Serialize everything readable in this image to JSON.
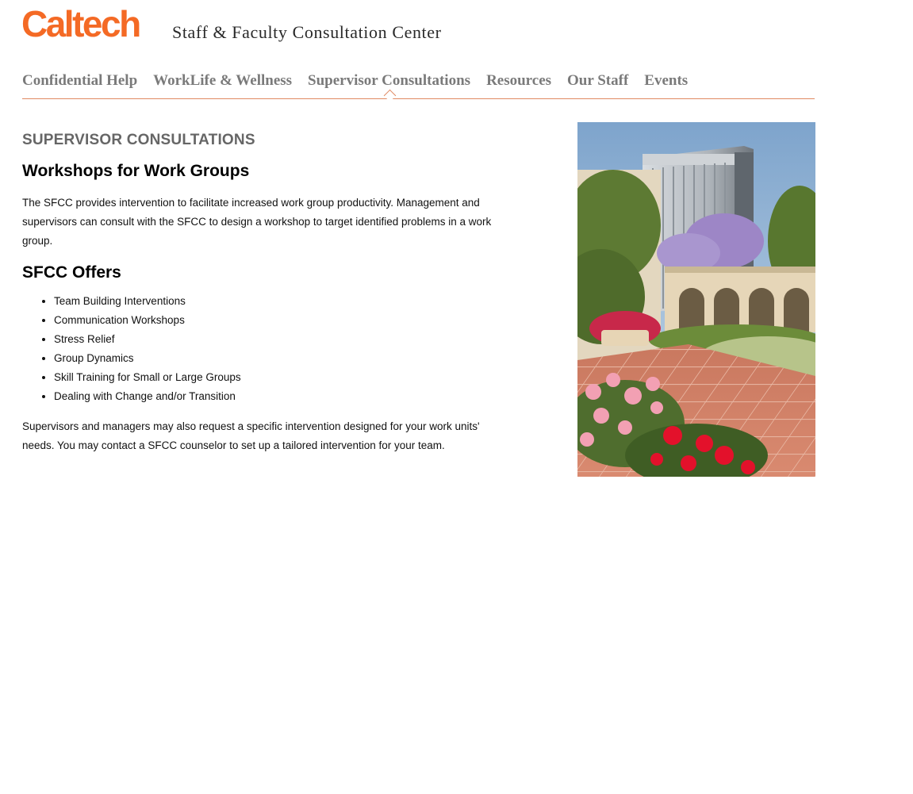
{
  "header": {
    "logo_text": "Caltech",
    "site_title": "Staff & Faculty Consultation Center"
  },
  "nav": {
    "items": [
      {
        "label": "Confidential Help"
      },
      {
        "label": "WorkLife & Wellness"
      },
      {
        "label": "Supervisor Consultations"
      },
      {
        "label": "Resources"
      },
      {
        "label": "Our Staff"
      },
      {
        "label": "Events"
      }
    ],
    "active_item": "Supervisor Consultations"
  },
  "main": {
    "section_title": "SUPERVISOR CONSULTATIONS",
    "heading_workshops": "Workshops for Work Groups",
    "intro_paragraph": "The SFCC provides intervention to facilitate increased work group productivity. Management and supervisors can consult with the SFCC to design a workshop to target identified problems in a work group.",
    "heading_offers": "SFCC Offers",
    "offers": [
      "Team Building Interventions",
      "Communication Workshops",
      "Stress Relief",
      "Group Dynamics",
      "Skill Training for Small or Large Groups",
      "Dealing with Change and/or Transition"
    ],
    "closing_paragraph": "Supervisors and managers may also request a specific intervention designed for your work units' needs.  You may contact a SFCC counselor to set up a tailored intervention for your team."
  },
  "colors": {
    "brand_orange": "#f46a25",
    "nav_text": "#7a7a7a",
    "nav_rule": "#e08a62",
    "section_title": "#666666"
  },
  "image": {
    "icon": "campus-photo"
  }
}
